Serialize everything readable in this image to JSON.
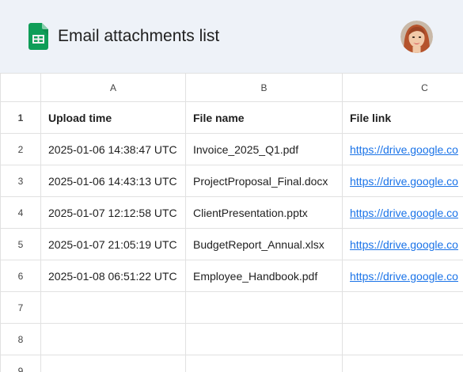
{
  "app": {
    "title": "Email attachments list",
    "icon": "google-sheets-icon",
    "avatar": "user-avatar",
    "colors": {
      "header_bg": "#eef2f8",
      "sheets_green": "#0f9d58",
      "link": "#1a73e8",
      "grid_line": "#e1e1e1"
    }
  },
  "columns": [
    "A",
    "B",
    "C"
  ],
  "row_numbers": [
    "1",
    "2",
    "3",
    "4",
    "5",
    "6",
    "7",
    "8",
    "9"
  ],
  "headers": {
    "a": "Upload time",
    "b": "File name",
    "c": "File link"
  },
  "rows": [
    {
      "time": "2025-01-06 14:38:47 UTC",
      "name": "Invoice_2025_Q1.pdf",
      "link": "https://drive.google.co"
    },
    {
      "time": "2025-01-06 14:43:13 UTC",
      "name": "ProjectProposal_Final.docx",
      "link": "https://drive.google.co"
    },
    {
      "time": "2025-01-07 12:12:58 UTC",
      "name": "ClientPresentation.pptx",
      "link": "https://drive.google.co"
    },
    {
      "time": "2025-01-07 21:05:19 UTC",
      "name": "BudgetReport_Annual.xlsx",
      "link": "https://drive.google.co"
    },
    {
      "time": "2025-01-08 06:51:22 UTC",
      "name": "Employee_Handbook.pdf",
      "link": "https://drive.google.co"
    }
  ]
}
